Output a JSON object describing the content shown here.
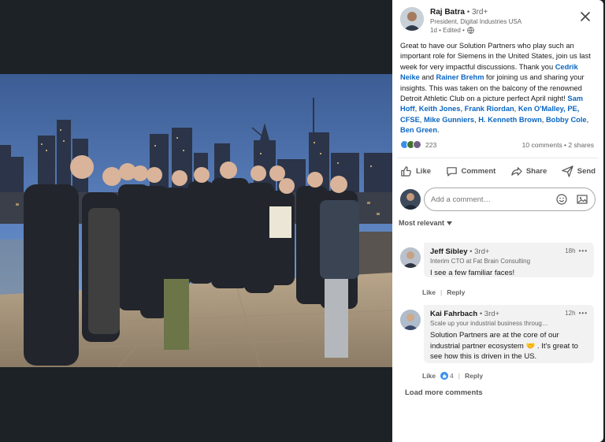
{
  "post": {
    "author_name": "Raj Batra",
    "author_degree": "• 3rd+",
    "author_title": "President, Digital Industries USA",
    "meta": "1d • Edited •",
    "text_parts": {
      "t1": "Great to have our Solution Partners who play such an important role for Siemens in the United States, join us last week for very impactful discussions. Thank you ",
      "m1": "Cedrik Neike",
      "t2": " and ",
      "m2": "Rainer Brehm",
      "t3": " for joining us and sharing your insights. This was taken on the balcony of the renowned Detroit Athletic Club on a picture perfect April night! ",
      "m3": "Sam Hoff",
      "t4": ", ",
      "m4": "Keith Jones",
      "t5": ", ",
      "m5": "Frank Riordan",
      "t6": ", ",
      "m6": "Ken O'Malley, PE, CFSE",
      "t7": ", ",
      "m7": "Mike Gunniers",
      "t8": ", ",
      "m8": "H. Kenneth Brown",
      "t9": ", ",
      "m9": "Bobby Cole",
      "t10": ", ",
      "m10": "Ben Green",
      "t11": "."
    },
    "reaction_count": "223",
    "comments_shares": "10 comments • 2 shares",
    "colors": {
      "mention": "#0a66c2",
      "like_blue": "#378fe9",
      "celebrate_green": "#44712e",
      "support_purple": "#715e86"
    }
  },
  "actions": {
    "like": "Like",
    "comment": "Comment",
    "share": "Share",
    "send": "Send"
  },
  "comment_box": {
    "placeholder": "Add a comment…"
  },
  "sort_label": "Most relevant",
  "comments": [
    {
      "name": "Jeff Sibley",
      "degree": "• 3rd+",
      "headline": "Interim CTO at Fat Brain Consulting",
      "time": "18h",
      "text": "I see a few familiar faces!",
      "like": "Like",
      "reply": "Reply"
    },
    {
      "name": "Kai Fahrbach",
      "degree": "• 3rd+",
      "headline": "Scale up your industrial business throug…",
      "time": "12h",
      "text": "Solution Partners are at the core of our industrial partner ecosystem 🤝 . It's great to see how this is driven in the US.",
      "like": "Like",
      "like_count": "4",
      "reply": "Reply"
    }
  ],
  "load_more": "Load more comments",
  "more_glyph": "•••",
  "sep_glyph": "|"
}
